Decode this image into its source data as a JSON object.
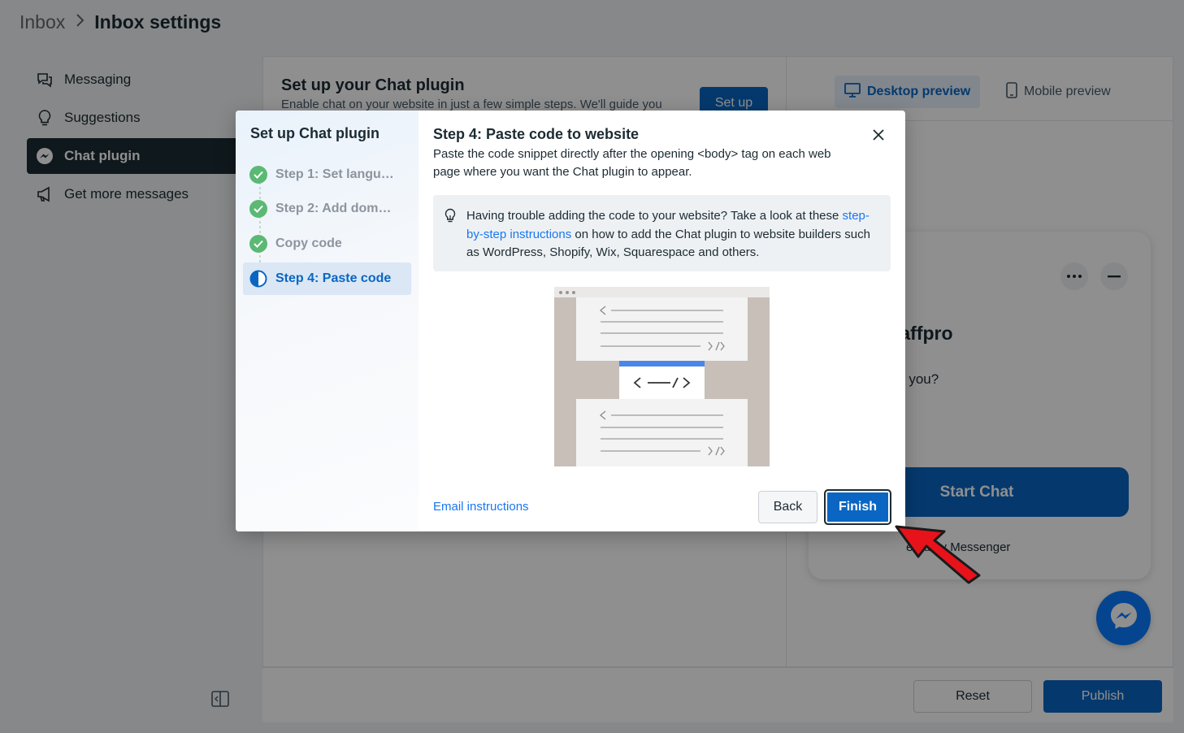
{
  "breadcrumb": {
    "root": "Inbox",
    "separator": ">",
    "current": "Inbox settings"
  },
  "sidebar": {
    "items": [
      {
        "label": "Messaging",
        "icon": "chat-bubbles-icon",
        "active": false
      },
      {
        "label": "Suggestions",
        "icon": "lightbulb-icon",
        "active": false
      },
      {
        "label": "Chat plugin",
        "icon": "messenger-icon",
        "active": true
      },
      {
        "label": "Get more messages",
        "icon": "megaphone-icon",
        "active": false
      }
    ]
  },
  "main": {
    "title": "Set up your Chat plugin",
    "description": "Enable chat on your website in just a few simple steps. We'll guide you",
    "setup_label": "Set up"
  },
  "preview": {
    "tabs": [
      {
        "label": "Desktop preview",
        "icon": "monitor-icon",
        "active": true
      },
      {
        "label": "Mobile preview",
        "icon": "phone-icon",
        "active": false
      }
    ],
    "widget": {
      "title": "n Goaffpro",
      "greeting": "we help you?",
      "start_chat": "Start Chat",
      "powered": "ered by Messenger"
    }
  },
  "footer": {
    "reset": "Reset",
    "publish": "Publish"
  },
  "modal": {
    "sidebar_title": "Set up Chat plugin",
    "steps": [
      {
        "label": "Step 1: Set langu…",
        "status": "done"
      },
      {
        "label": "Step 2: Add dom…",
        "status": "done"
      },
      {
        "label": "Copy code",
        "status": "done"
      },
      {
        "label": "Step 4: Paste code",
        "status": "current"
      }
    ],
    "title": "Step 4: Paste code to website",
    "description": "Paste the code snippet directly after the opening <body> tag on each web page where you want the Chat plugin to appear.",
    "tip": {
      "before": "Having trouble adding the code to your website? Take a look at these ",
      "link": "step-by-step instructions",
      "after": " on how to add the Chat plugin to website builders such as WordPress, Shopify, Wix, Squarespace and others."
    },
    "email_instructions": "Email instructions",
    "back": "Back",
    "finish": "Finish"
  },
  "colors": {
    "accent": "#0a66c2",
    "link": "#1877f2",
    "success": "#5bb974",
    "pointer": "#e8121b",
    "messenger": "#0a7cff"
  }
}
